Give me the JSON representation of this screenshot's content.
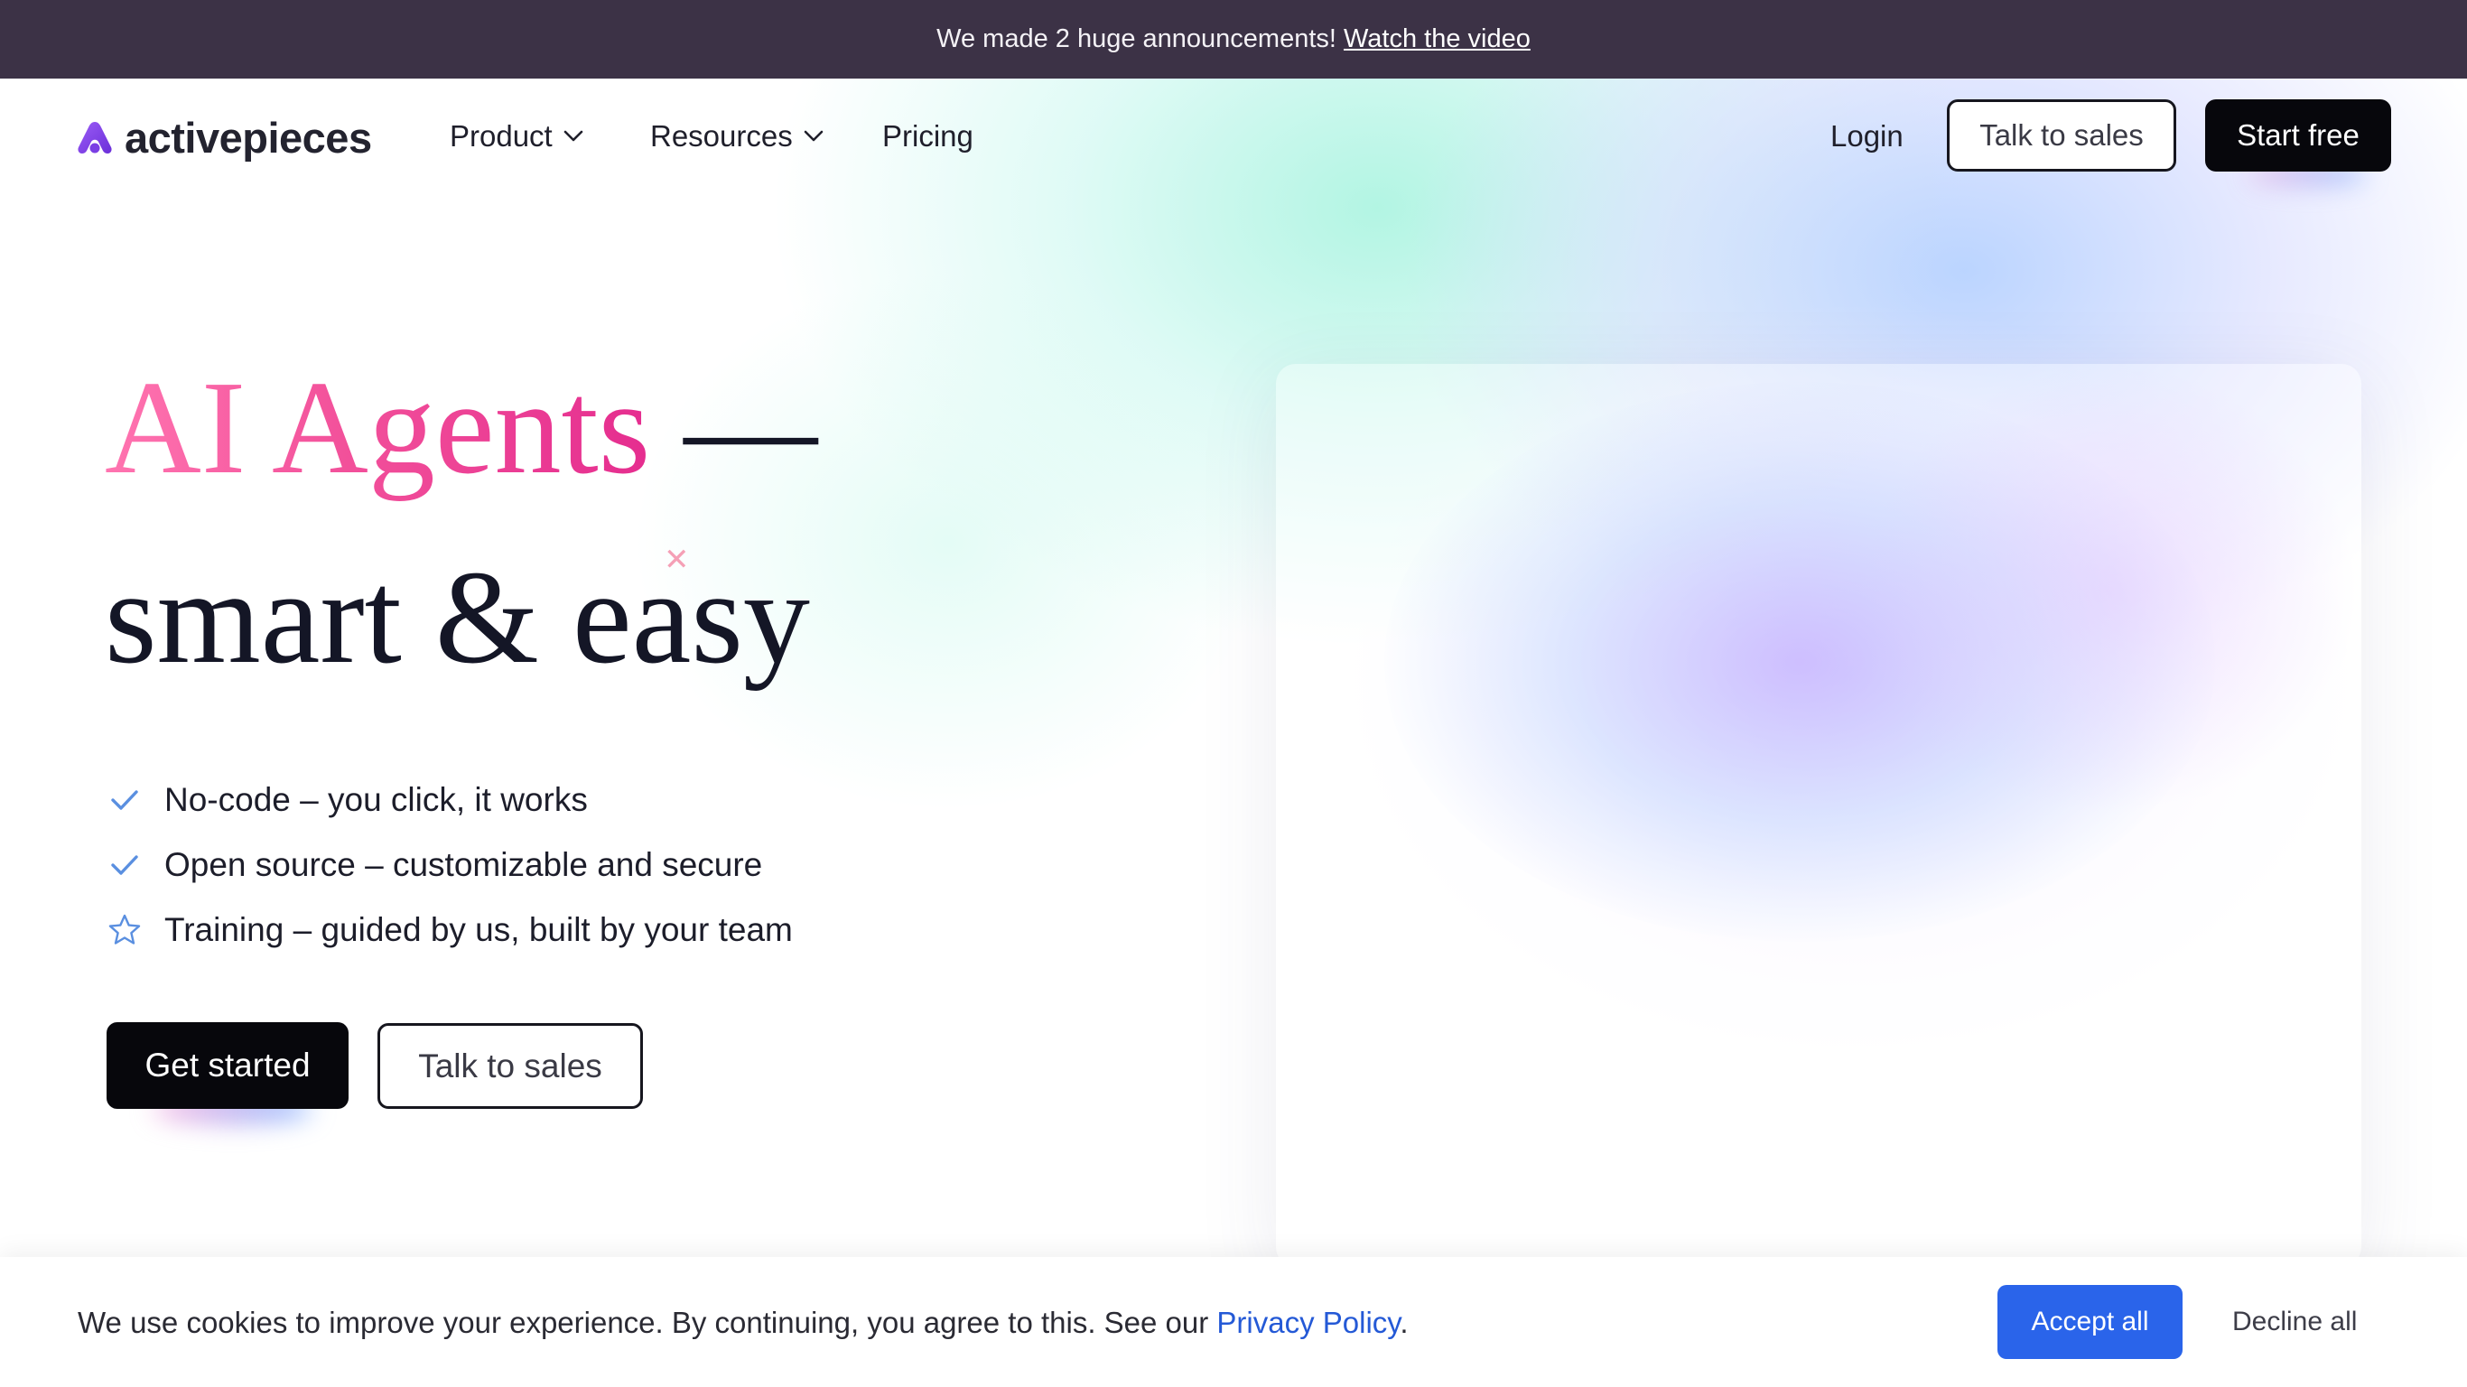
{
  "announcement": {
    "text": "We made 2 huge announcements!",
    "link": "Watch the video"
  },
  "nav": {
    "logo_text": "activepieces",
    "product": "Product",
    "resources": "Resources",
    "pricing": "Pricing",
    "login": "Login",
    "talk_to_sales": "Talk to sales",
    "start_free": "Start free"
  },
  "hero": {
    "title_highlight": "AI Agents",
    "title_dash": " —",
    "title_line2": "smart & easy",
    "features": [
      {
        "icon": "check-icon",
        "text": "No-code – you click, it works"
      },
      {
        "icon": "check-icon",
        "text": "Open source – customizable and secure"
      },
      {
        "icon": "star-icon",
        "text": "Training – guided by us, built by your team"
      }
    ],
    "get_started": "Get started",
    "talk_to_sales": "Talk to sales"
  },
  "cookie": {
    "text": "We use cookies to improve your experience. By continuing, you agree to this. See our",
    "link": "Privacy Policy",
    "period": ".",
    "accept": "Accept all",
    "decline": "Decline all"
  },
  "colors": {
    "announcement_bg": "#3c3246",
    "accent_pink": "#e52d8f",
    "logo_purple": "#7b3fe4",
    "accept_blue": "#2a64ea",
    "link_blue": "#2459d6"
  }
}
